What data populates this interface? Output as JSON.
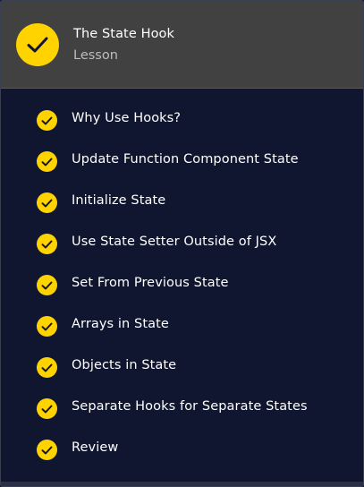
{
  "header": {
    "title": "The State Hook",
    "subtitle": "Lesson",
    "icon": "check-icon",
    "accent_color": "#ffd300",
    "background_color": "#414141"
  },
  "lesson_items": [
    {
      "label": "Why Use Hooks?",
      "icon": "check-icon"
    },
    {
      "label": "Update Function Component State",
      "icon": "check-icon"
    },
    {
      "label": "Initialize State",
      "icon": "check-icon"
    },
    {
      "label": "Use State Setter Outside of JSX",
      "icon": "check-icon"
    },
    {
      "label": "Set From Previous State",
      "icon": "check-icon"
    },
    {
      "label": "Arrays in State",
      "icon": "check-icon"
    },
    {
      "label": "Objects in State",
      "icon": "check-icon"
    },
    {
      "label": "Separate Hooks for Separate States",
      "icon": "check-icon"
    },
    {
      "label": "Review",
      "icon": "check-icon"
    }
  ],
  "colors": {
    "list_background": "#10162f",
    "text": "#ffffff",
    "muted_text": "#bdbdbd"
  }
}
